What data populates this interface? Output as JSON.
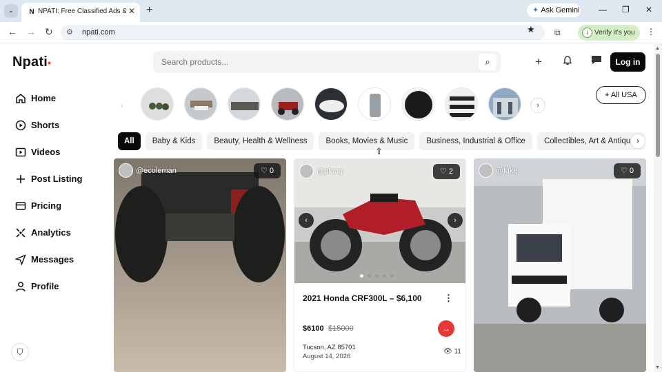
{
  "browser": {
    "tab_title": "NPATI: Free Classified Ads & Vi",
    "tab_favicon": "N",
    "url": "npati.com",
    "gemini_label": "Ask Gemini",
    "verify_label": "Verify it's you"
  },
  "site": {
    "logo": "Npati",
    "search_placeholder": "Search products...",
    "login_label": "Log in",
    "location_label": "All USA"
  },
  "sidebar": {
    "items": [
      {
        "label": "Home",
        "icon": "home-icon"
      },
      {
        "label": "Shorts",
        "icon": "play-icon"
      },
      {
        "label": "Videos",
        "icon": "video-icon"
      },
      {
        "label": "Post Listing",
        "icon": "plus-icon"
      },
      {
        "label": "Pricing",
        "icon": "card-icon"
      },
      {
        "label": "Analytics",
        "icon": "analytics-icon"
      },
      {
        "label": "Messages",
        "icon": "send-icon"
      },
      {
        "label": "Profile",
        "icon": "user-icon"
      }
    ]
  },
  "categories": [
    "All",
    "Baby & Kids",
    "Beauty, Health & Wellness",
    "Books, Movies & Music",
    "Business, Industrial & Office",
    "Collectibles, Art & Antiques"
  ],
  "listings": [
    {
      "username": "@ecoleman",
      "likes": "0"
    },
    {
      "username": "@plong",
      "likes": "2",
      "title": "2021 Honda CRF300L – $6,100",
      "price": "$6100",
      "old_price": "$15000",
      "location": "Tucson, AZ 85701",
      "date": "August 14, 2026",
      "views": "11"
    },
    {
      "username": "@luke",
      "likes": "0"
    }
  ],
  "colors": {
    "accent": "#e53935",
    "dark": "#0a0a0a"
  }
}
